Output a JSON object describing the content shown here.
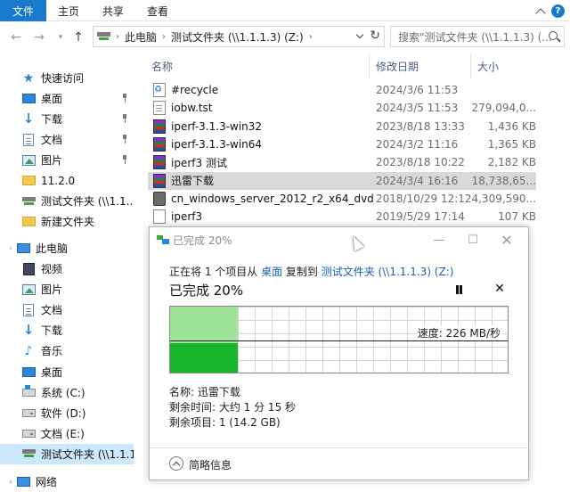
{
  "ribbon": {
    "tabs": [
      {
        "label": "文件",
        "active": true
      },
      {
        "label": "主页",
        "active": false
      },
      {
        "label": "共享",
        "active": false
      },
      {
        "label": "查看",
        "active": false
      }
    ],
    "help_label": "?"
  },
  "address": {
    "crumbs": [
      "此电脑",
      "测试文件夹 (\\\\1.1.1.3) (Z:)"
    ],
    "search_placeholder": "搜索\"测试文件夹 (\\\\1.1.1.3) (..."
  },
  "sidebar": {
    "quick_access": "快速访问",
    "quick_items": [
      {
        "label": "桌面",
        "icon": "desktop-icon",
        "pinned": true
      },
      {
        "label": "下载",
        "icon": "download-icon",
        "pinned": true
      },
      {
        "label": "文档",
        "icon": "documents-icon",
        "pinned": true
      },
      {
        "label": "图片",
        "icon": "pictures-icon",
        "pinned": true
      },
      {
        "label": "11.2.0",
        "icon": "folder-icon",
        "pinned": false
      },
      {
        "label": "测试文件夹 (\\\\1.1...",
        "icon": "network-drive-icon",
        "pinned": false
      },
      {
        "label": "新建文件夹",
        "icon": "folder-icon",
        "pinned": false
      }
    ],
    "this_pc": "此电脑",
    "pc_items": [
      {
        "label": "视频",
        "icon": "video-icon"
      },
      {
        "label": "图片",
        "icon": "pictures-icon"
      },
      {
        "label": "文档",
        "icon": "documents-icon"
      },
      {
        "label": "下载",
        "icon": "download-icon"
      },
      {
        "label": "音乐",
        "icon": "music-icon"
      },
      {
        "label": "桌面",
        "icon": "desktop-icon"
      },
      {
        "label": "系统 (C:)",
        "icon": "system-drive-icon"
      },
      {
        "label": "软件 (D:)",
        "icon": "drive-icon"
      },
      {
        "label": "文档 (E:)",
        "icon": "drive-icon"
      },
      {
        "label": "测试文件夹 (\\\\1.1.1",
        "icon": "network-drive-icon",
        "selected": true
      }
    ],
    "network": "网络"
  },
  "filelist": {
    "columns": {
      "name": "名称",
      "date": "修改日期",
      "size": "大小"
    },
    "files": [
      {
        "name": "#recycle",
        "date": "2024/3/6 11:53",
        "size": "",
        "icon": "recycle-folder-icon"
      },
      {
        "name": "iobw.tst",
        "date": "2024/3/5 11:53",
        "size": "279,094,0...",
        "icon": "text-file-icon"
      },
      {
        "name": "iperf-3.1.3-win32",
        "date": "2023/8/18 13:33",
        "size": "1,436 KB",
        "icon": "rar-archive-icon"
      },
      {
        "name": "iperf-3.1.3-win64",
        "date": "2024/3/2 11:16",
        "size": "1,365 KB",
        "icon": "rar-archive-icon"
      },
      {
        "name": "iperf3  测试",
        "date": "2023/8/18 10:22",
        "size": "2,182 KB",
        "icon": "rar-archive-icon"
      },
      {
        "name": "迅雷下载",
        "date": "2024/3/4 16:16",
        "size": "18,738,65...",
        "icon": "rar-archive-icon",
        "selected": true
      },
      {
        "name": "cn_windows_server_2012_r2_x64_dvd_...",
        "date": "2018/10/29 12:12",
        "size": "4,309,590...",
        "icon": "iso-file-icon"
      },
      {
        "name": "iperf3",
        "date": "2019/5/29 17:14",
        "size": "107 KB",
        "icon": "blank-file-icon"
      }
    ]
  },
  "dialog": {
    "title": "已完成 20%",
    "line_prefix": "正在将 1 个项目从 ",
    "source": "桌面",
    "line_middle": " 复制到 ",
    "destination": "测试文件夹 (\\\\1.1.1.3) (Z:)",
    "headline": "已完成 20%",
    "progress_fraction": 0.2,
    "speed": "速度: 226 MB/秒",
    "name_line": "名称: 迅雷下载",
    "time_line": "剩余时间: 大约 1 分 15 秒",
    "items_line": "剩余项目: 1 (14.2 GB)",
    "details_label": "简略信息"
  }
}
